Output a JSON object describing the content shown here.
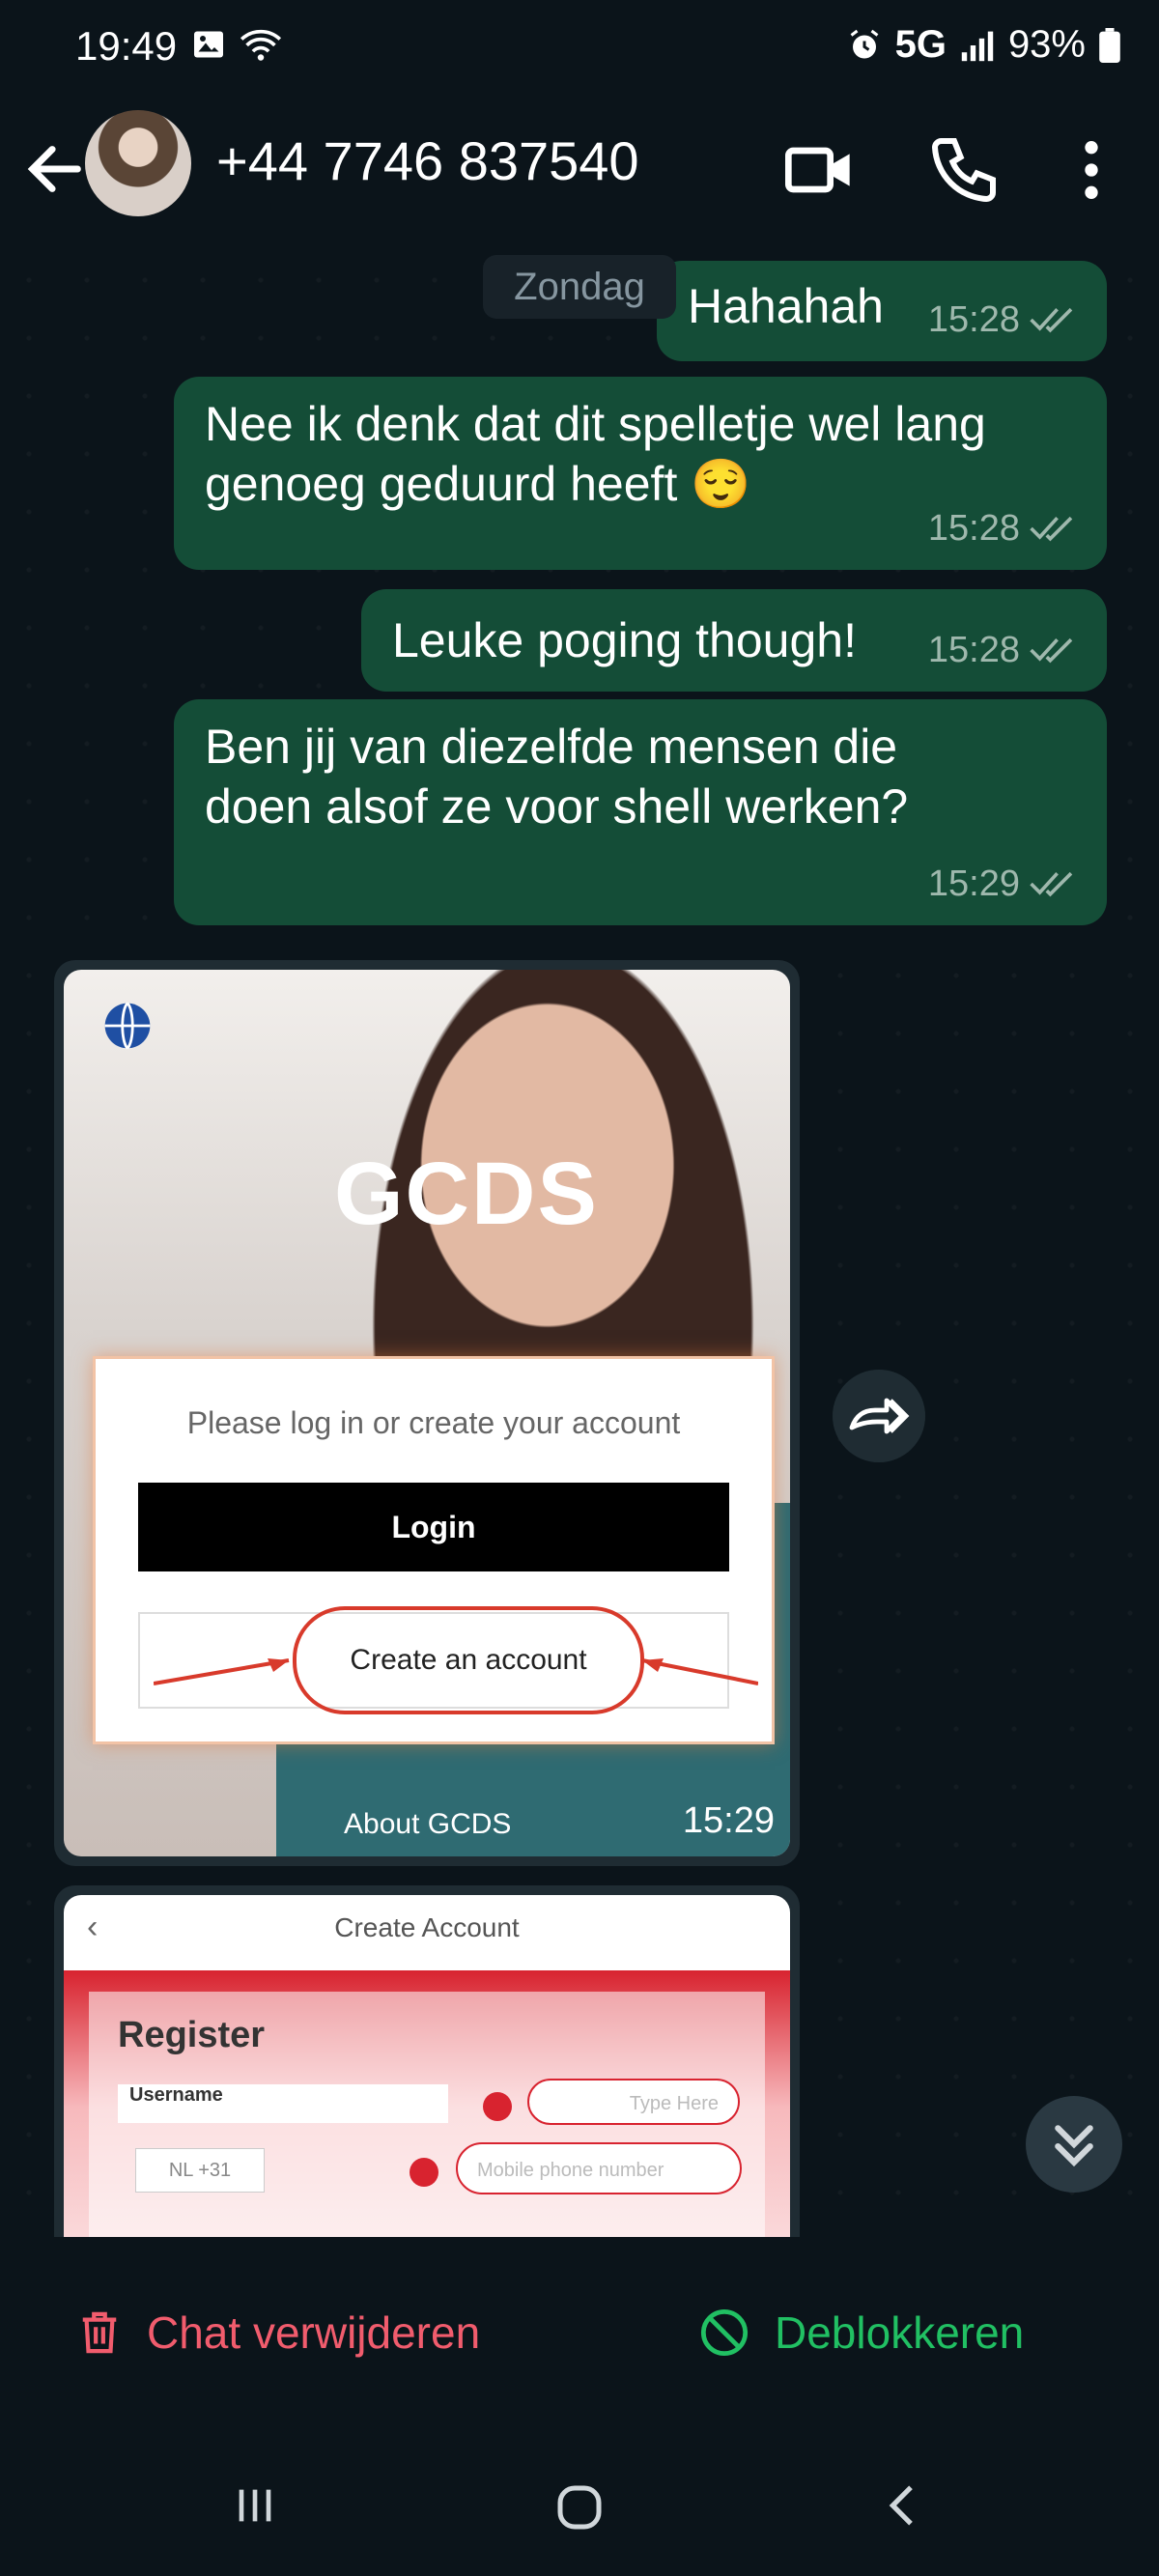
{
  "status_bar": {
    "time": "19:49",
    "network": "5G",
    "battery": "93%"
  },
  "header": {
    "contact": "+44 7746 837540"
  },
  "chat": {
    "date_chip": "Zondag",
    "messages": [
      {
        "text": "Hahahah",
        "time": "15:28"
      },
      {
        "text": "Nee ik denk dat dit spelletje wel lang genoeg geduurd heeft 😌",
        "time": "15:28"
      },
      {
        "text": "Leuke poging though!",
        "time": "15:28"
      },
      {
        "text": "Ben jij van diezelfde mensen die doen alsof ze voor shell werken?",
        "time": "15:29"
      }
    ],
    "image1": {
      "brand": "GCDS",
      "prompt": "Please log in or create your account",
      "login": "Login",
      "create": "Create an account",
      "footer": "About GCDS",
      "time": "15:29"
    },
    "image2": {
      "title": "Create Account",
      "heading": "Register",
      "username_label": "Username",
      "field1": "Type Here",
      "field2": "Mobile phone number",
      "code": "NL +31"
    }
  },
  "actions": {
    "delete": "Chat verwijderen",
    "unblock": "Deblokkeren"
  },
  "colors": {
    "delete": "#f15c6d",
    "unblock": "#21c063",
    "bubble": "#144d37",
    "tick": "#9fb8ad"
  }
}
